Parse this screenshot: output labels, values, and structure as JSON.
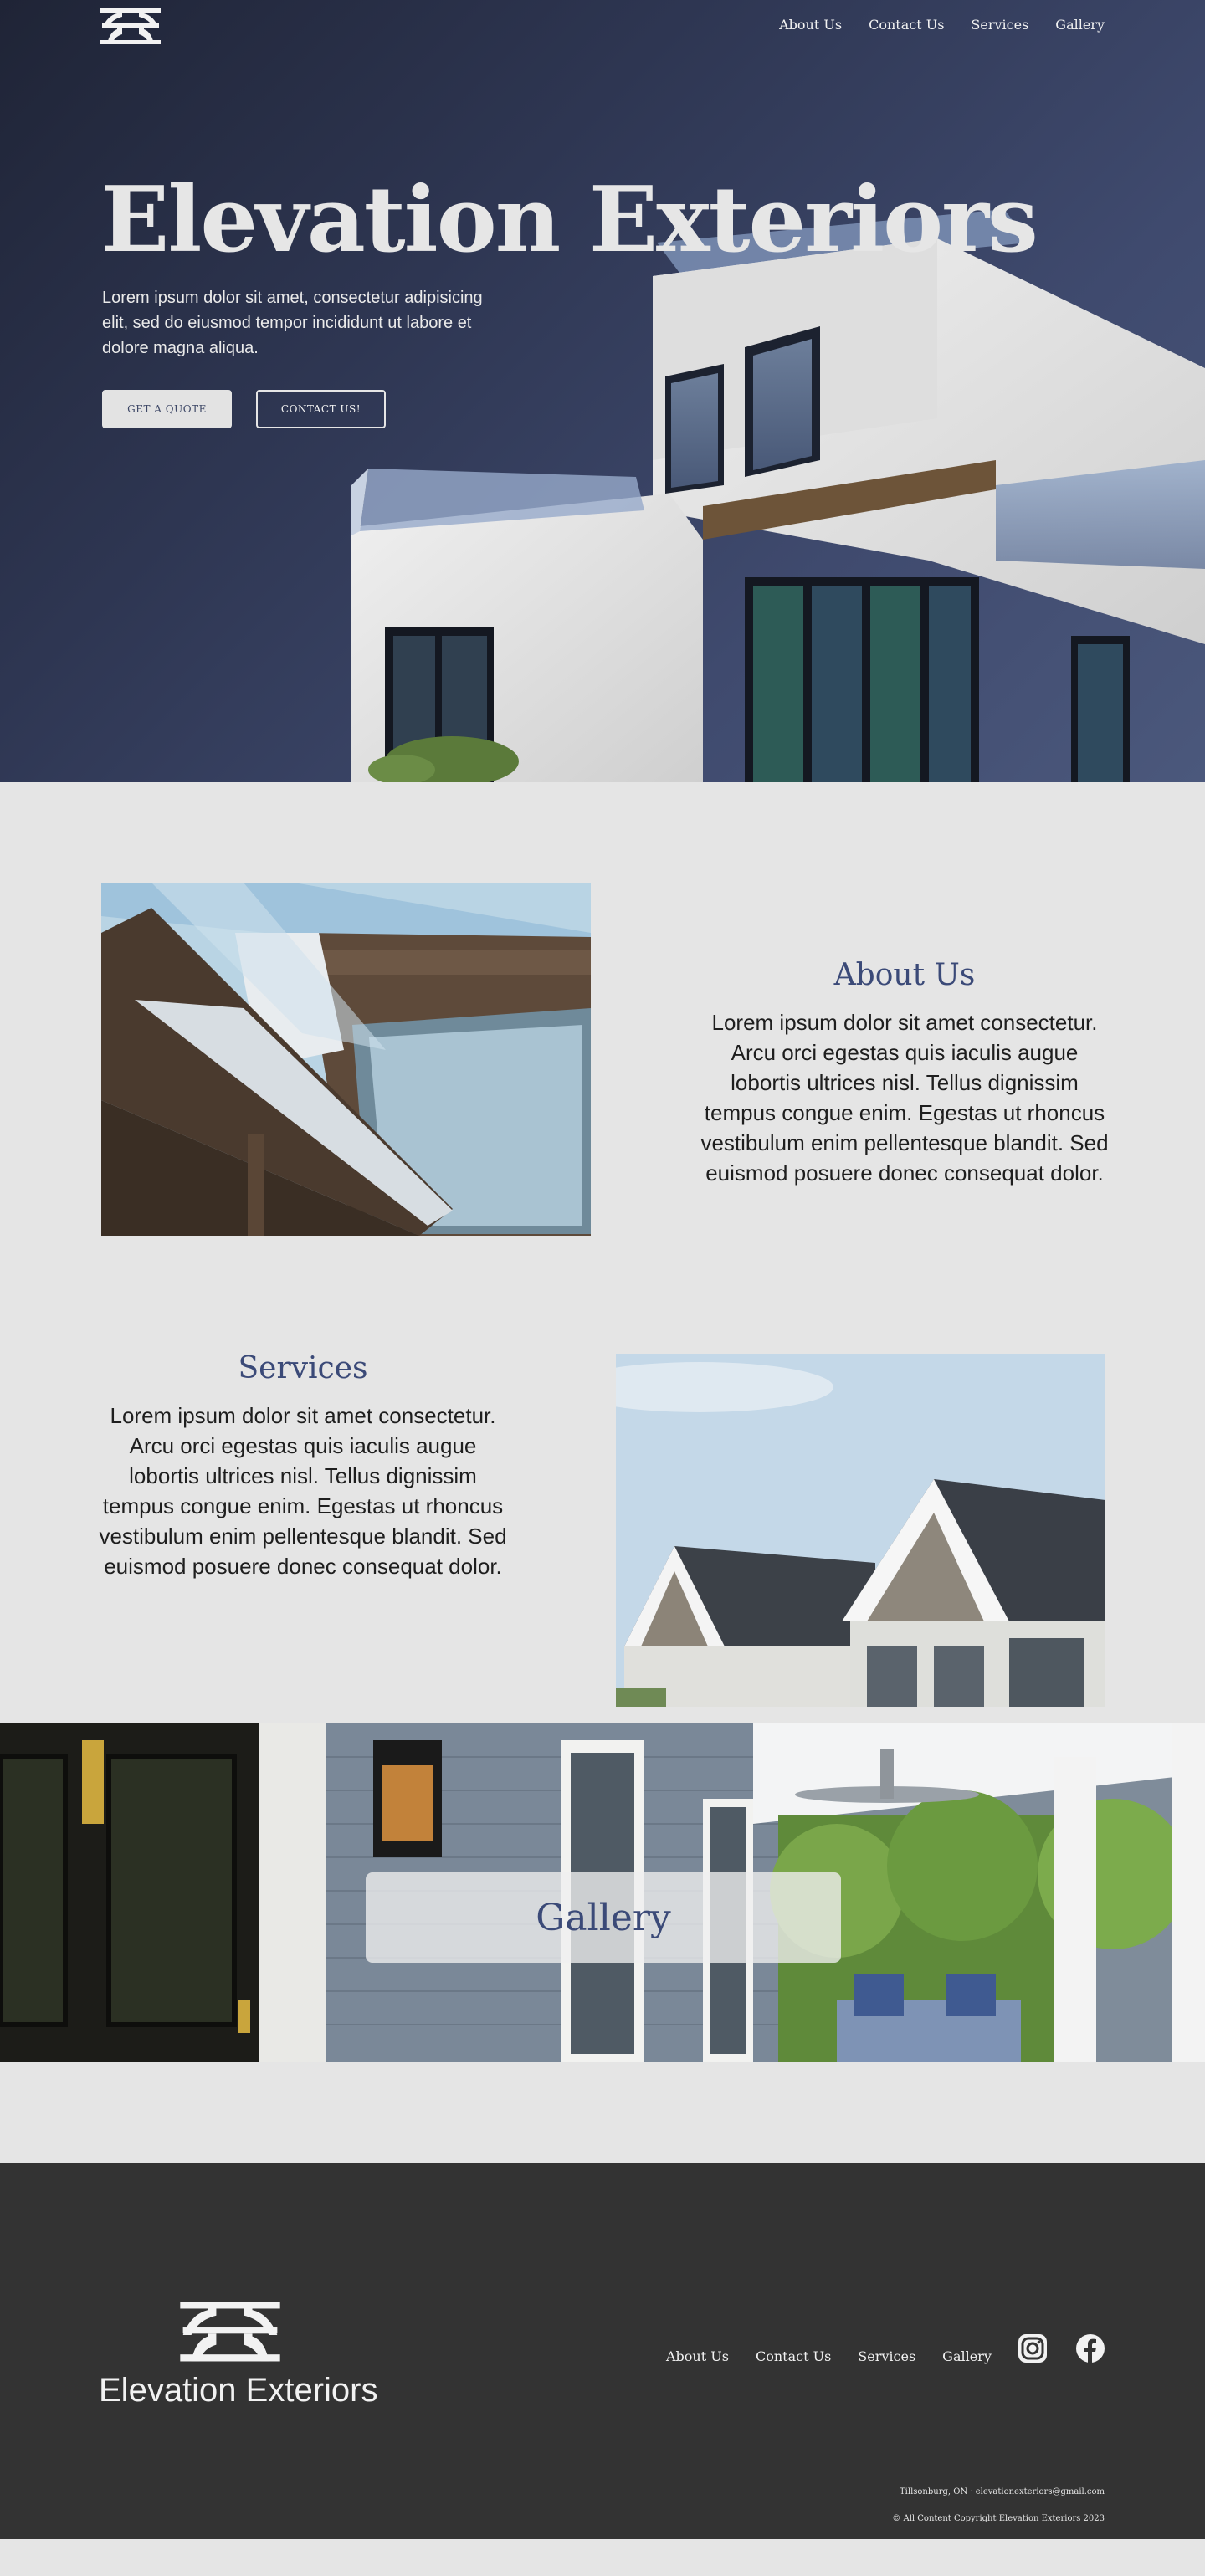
{
  "nav": {
    "brand_logo": "ee-monogram-logo",
    "links": [
      "About Us",
      "Contact Us",
      "Services",
      "Gallery"
    ]
  },
  "hero": {
    "title": "Elevation Exteriors",
    "lead": "Lorem ipsum dolor sit amet, consectetur adipisicing elit, sed do eiusmod tempor incididunt ut labore et dolore magna aliqua.",
    "primary_button": "GET A QUOTE",
    "secondary_button": "CONTACT US!"
  },
  "about": {
    "heading": "About Us",
    "body": "Lorem ipsum dolor sit amet consectetur. Arcu orci egestas quis iaculis augue lobortis ultrices nisl. Tellus dignissim tempus congue enim. Egestas ut rhoncus vestibulum enim pellentesque blandit. Sed euismod posuere donec consequat dolor."
  },
  "services": {
    "heading": "Services",
    "body": "Lorem ipsum dolor sit amet consectetur. Arcu orci egestas quis iaculis augue lobortis ultrices nisl. Tellus dignissim tempus congue enim. Egestas ut rhoncus vestibulum enim pellentesque blandit. Sed euismod posuere donec consequat dolor."
  },
  "gallery": {
    "label": "Gallery"
  },
  "footer": {
    "brand_name": "Elevation Exteriors",
    "links": [
      "About Us",
      "Contact Us",
      "Services",
      "Gallery"
    ],
    "social": [
      "instagram-icon",
      "facebook-icon"
    ],
    "contact_line": "Tillsonburg, ON · elevationexteriors@gmail.com",
    "copyright": "© All Content Copyright Elevation Exteriors 2023"
  },
  "colors": {
    "hero_gradient_dark": "#1f2436",
    "hero_gradient_light": "#4b587c",
    "accent_heading": "#3b4a78",
    "page_background": "#e5e5e5",
    "footer_background": "#333333"
  }
}
